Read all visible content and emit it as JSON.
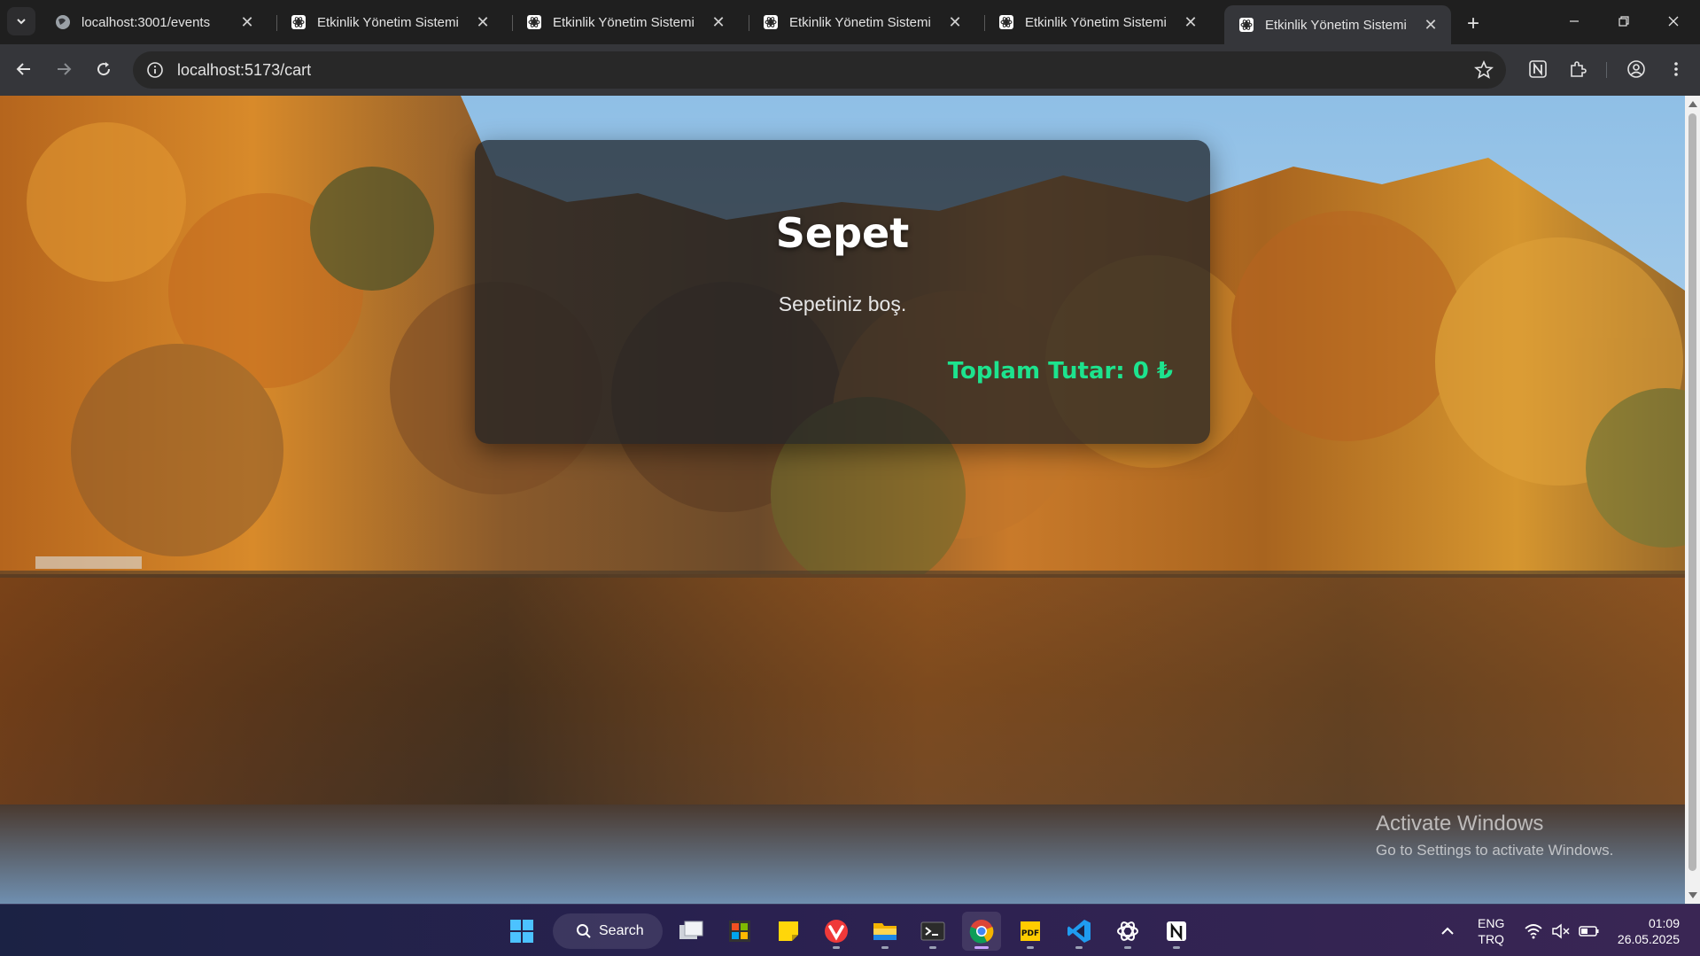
{
  "browser": {
    "tabs": [
      {
        "title": "localhost:3001/events",
        "favicon": "globe-icon",
        "active": false
      },
      {
        "title": "Etkinlik Yönetim Sistemi",
        "favicon": "react-icon",
        "active": false
      },
      {
        "title": "Etkinlik Yönetim Sistemi",
        "favicon": "react-icon",
        "active": false
      },
      {
        "title": "Etkinlik Yönetim Sistemi",
        "favicon": "react-icon",
        "active": false
      },
      {
        "title": "Etkinlik Yönetim Sistemi",
        "favicon": "react-icon",
        "active": false
      },
      {
        "title": "Etkinlik Yönetim Sistemi",
        "favicon": "react-icon",
        "active": true
      }
    ],
    "address": "localhost:5173/cart"
  },
  "page": {
    "cart_title": "Sepet",
    "empty_message": "Sepetiniz boş.",
    "total_label": "Toplam Tutar: 0 ₺",
    "accent_color": "#1de38e"
  },
  "watermark": {
    "title": "Activate Windows",
    "subtitle": "Go to Settings to activate Windows."
  },
  "taskbar": {
    "search_label": "Search",
    "apps": [
      "start-icon",
      "task-view-icon",
      "store-icon",
      "sticky-notes-icon",
      "vivaldi-icon",
      "file-explorer-icon",
      "terminal-icon",
      "chrome-icon",
      "pdf-icon",
      "vscode-icon",
      "chatgpt-icon",
      "notion-icon"
    ],
    "language_top": "ENG",
    "language_bottom": "TRQ",
    "time": "01:09",
    "date": "26.05.2025"
  }
}
